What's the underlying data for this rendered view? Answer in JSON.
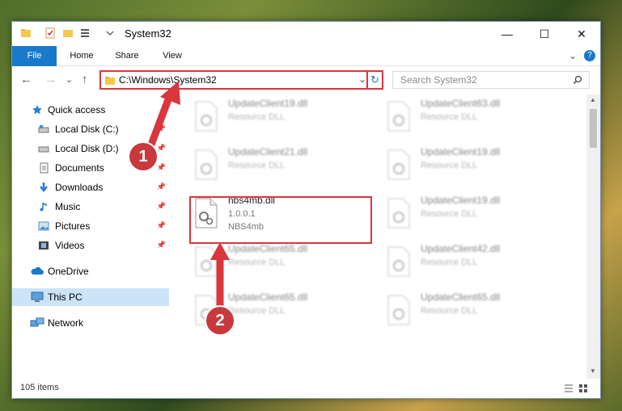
{
  "window": {
    "title": "System32",
    "minimize": "—",
    "maximize": "☐",
    "close": "✕"
  },
  "ribbon": {
    "tabs": [
      "File",
      "Home",
      "Share",
      "View"
    ],
    "expand": "⌄",
    "help": "?"
  },
  "nav": {
    "back": "←",
    "forward": "→",
    "recent": "⌄",
    "up": "↑",
    "address": "C:\\Windows\\System32",
    "refresh": "↻",
    "search_placeholder": "Search System32"
  },
  "sidebar": {
    "items": [
      {
        "label": "Quick access"
      },
      {
        "label": "Local Disk (C:)"
      },
      {
        "label": "Local Disk (D:)"
      },
      {
        "label": "Documents"
      },
      {
        "label": "Downloads"
      },
      {
        "label": "Music"
      },
      {
        "label": "Pictures"
      },
      {
        "label": "Videos"
      },
      {
        "label": "OneDrive"
      },
      {
        "label": "This PC"
      },
      {
        "label": "Network"
      }
    ]
  },
  "files": [
    {
      "name": "UpdateClient19.dll",
      "desc": "Resource DLL",
      "version": ""
    },
    {
      "name": "UpdateClient63.dll",
      "desc": "Resource DLL",
      "version": ""
    },
    {
      "name": "UpdateClient21.dll",
      "desc": "Resource DLL",
      "version": ""
    },
    {
      "name": "UpdateClient19.dll",
      "desc": "Resource DLL",
      "version": ""
    },
    {
      "name": "nbs4mb.dll",
      "desc": "1.0.0.1",
      "version": "NBS4mb"
    },
    {
      "name": "UpdateClient19.dll",
      "desc": "Resource DLL",
      "version": ""
    },
    {
      "name": "UpdateClient65.dll",
      "desc": "Resource DLL",
      "version": ""
    },
    {
      "name": "UpdateClient42.dll",
      "desc": "Resource DLL",
      "version": ""
    },
    {
      "name": "UpdateClient65.dll",
      "desc": "Resource DLL",
      "version": ""
    },
    {
      "name": "UpdateClient65.dll",
      "desc": "Resource DLL",
      "version": ""
    }
  ],
  "status": {
    "count": "105 items"
  },
  "markers": [
    "1",
    "2"
  ],
  "colors": {
    "accent": "#1979ca",
    "highlight": "#d9363e"
  }
}
